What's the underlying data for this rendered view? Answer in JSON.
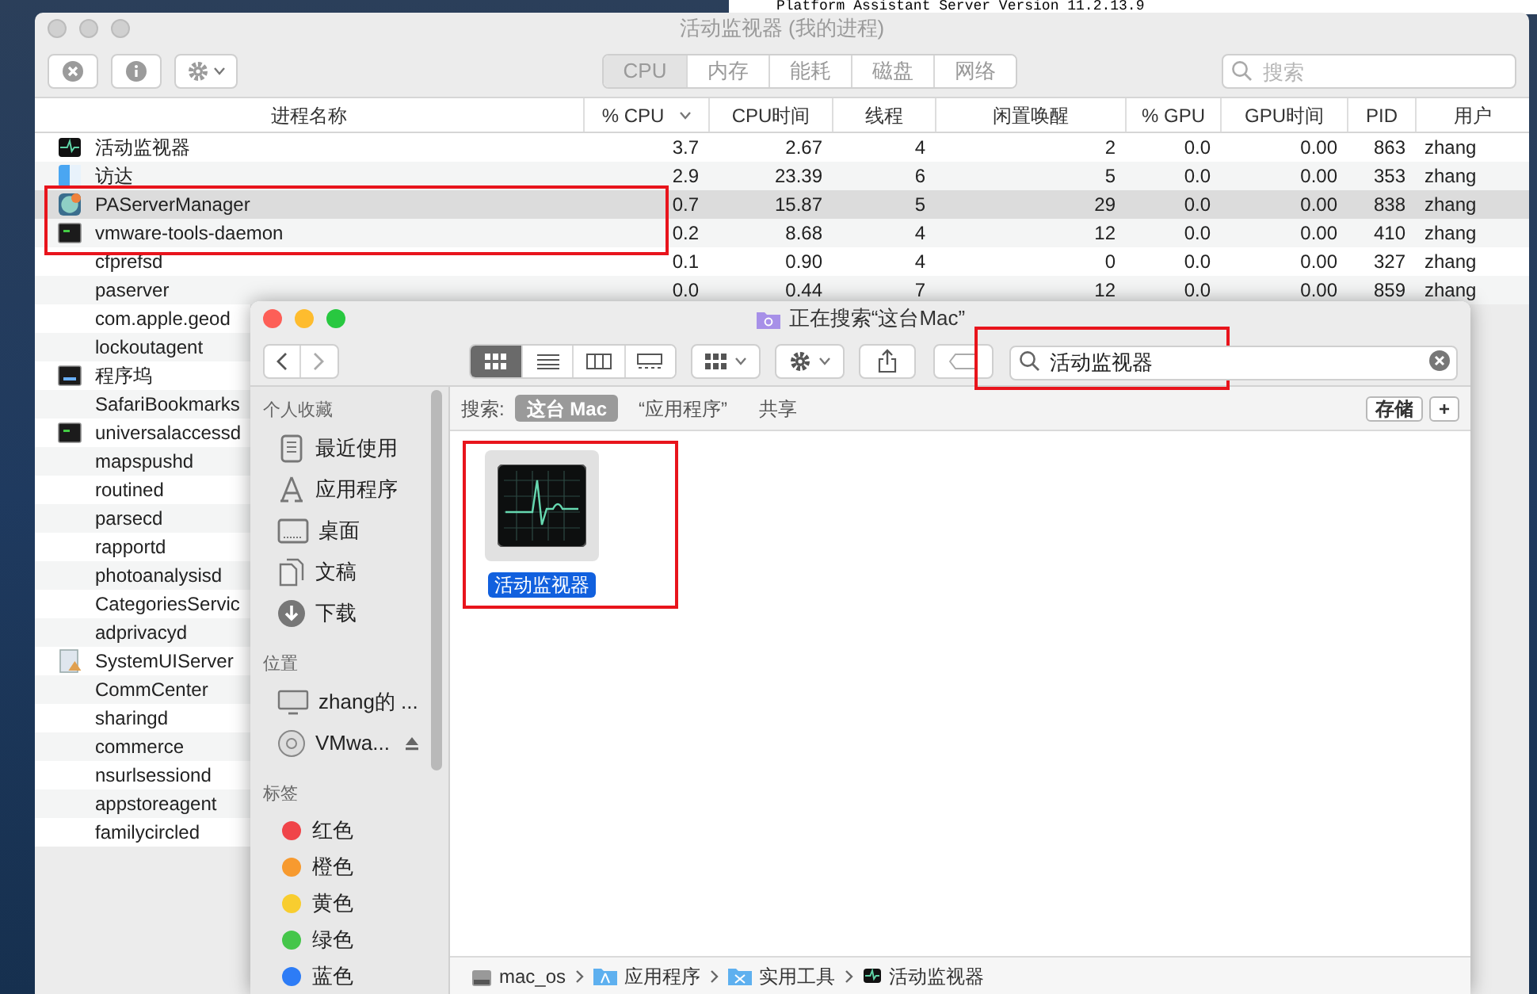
{
  "terminal_text": "Platform Assistant Server  Version 11.2.13.9",
  "activity_monitor": {
    "title": "活动监视器 (我的进程)",
    "tabs": [
      {
        "label": "CPU",
        "selected": true
      },
      {
        "label": "内存",
        "selected": false
      },
      {
        "label": "能耗",
        "selected": false
      },
      {
        "label": "磁盘",
        "selected": false
      },
      {
        "label": "网络",
        "selected": false
      }
    ],
    "search": {
      "placeholder": "搜索"
    },
    "columns": [
      {
        "label": "进程名称",
        "sorted": false
      },
      {
        "label": "% CPU",
        "sorted": true
      },
      {
        "label": "CPU时间",
        "sorted": false
      },
      {
        "label": "线程",
        "sorted": false
      },
      {
        "label": "闲置唤醒",
        "sorted": false
      },
      {
        "label": "% GPU",
        "sorted": false
      },
      {
        "label": "GPU时间",
        "sorted": false
      },
      {
        "label": "PID",
        "sorted": false
      },
      {
        "label": "用户",
        "sorted": false
      }
    ],
    "rows": [
      {
        "kind": "activity",
        "cells": [
          "活动监视器",
          "3.7",
          "2.67",
          "4",
          "2",
          "0.0",
          "0.00",
          "863",
          "zhang"
        ],
        "selected": false,
        "boxed": false
      },
      {
        "kind": "finder",
        "cells": [
          "访达",
          "2.9",
          "23.39",
          "6",
          "5",
          "0.0",
          "0.00",
          "353",
          "zhang"
        ],
        "selected": false,
        "boxed": false
      },
      {
        "kind": "app",
        "cells": [
          "PAServerManager",
          "0.7",
          "15.87",
          "5",
          "29",
          "0.0",
          "0.00",
          "838",
          "zhang"
        ],
        "selected": true,
        "boxed": true
      },
      {
        "kind": "terminal",
        "cells": [
          "vmware-tools-daemon",
          "0.2",
          "8.68",
          "4",
          "12",
          "0.0",
          "0.00",
          "410",
          "zhang"
        ],
        "selected": false,
        "boxed": true
      },
      {
        "kind": "none",
        "cells": [
          "cfprefsd",
          "0.1",
          "0.90",
          "4",
          "0",
          "0.0",
          "0.00",
          "327",
          "zhang"
        ],
        "selected": false,
        "boxed": false
      },
      {
        "kind": "none",
        "cells": [
          "paserver",
          "0.0",
          "0.44",
          "7",
          "12",
          "0.0",
          "0.00",
          "859",
          "zhang"
        ],
        "selected": false,
        "boxed": false
      },
      {
        "kind": "none",
        "cells": [
          "com.apple.geod"
        ],
        "selected": false,
        "boxed": false
      },
      {
        "kind": "none",
        "cells": [
          "lockoutagent"
        ],
        "selected": false,
        "boxed": false
      },
      {
        "kind": "dock",
        "cells": [
          "程序坞"
        ],
        "selected": false,
        "boxed": false
      },
      {
        "kind": "none",
        "cells": [
          "SafariBookmarks"
        ],
        "selected": false,
        "boxed": false
      },
      {
        "kind": "terminal",
        "cells": [
          "universalaccessd"
        ],
        "selected": false,
        "boxed": false
      },
      {
        "kind": "none",
        "cells": [
          "mapspushd"
        ],
        "selected": false,
        "boxed": false
      },
      {
        "kind": "none",
        "cells": [
          "routined"
        ],
        "selected": false,
        "boxed": false
      },
      {
        "kind": "none",
        "cells": [
          "parsecd"
        ],
        "selected": false,
        "boxed": false
      },
      {
        "kind": "none",
        "cells": [
          "rapportd"
        ],
        "selected": false,
        "boxed": false
      },
      {
        "kind": "none",
        "cells": [
          "photoanalysisd"
        ],
        "selected": false,
        "boxed": false
      },
      {
        "kind": "none",
        "cells": [
          "CategoriesServic"
        ],
        "selected": false,
        "boxed": false
      },
      {
        "kind": "none",
        "cells": [
          "adprivacyd"
        ],
        "selected": false,
        "boxed": false
      },
      {
        "kind": "ui-server",
        "cells": [
          "SystemUIServer"
        ],
        "selected": false,
        "boxed": false
      },
      {
        "kind": "none",
        "cells": [
          "CommCenter"
        ],
        "selected": false,
        "boxed": false
      },
      {
        "kind": "none",
        "cells": [
          "sharingd"
        ],
        "selected": false,
        "boxed": false
      },
      {
        "kind": "none",
        "cells": [
          "commerce"
        ],
        "selected": false,
        "boxed": false
      },
      {
        "kind": "none",
        "cells": [
          "nsurlsessiond"
        ],
        "selected": false,
        "boxed": false
      },
      {
        "kind": "none",
        "cells": [
          "appstoreagent"
        ],
        "selected": false,
        "boxed": false
      },
      {
        "kind": "none",
        "cells": [
          "familycircled"
        ],
        "selected": false,
        "boxed": false
      }
    ]
  },
  "finder": {
    "title": "正在搜索“这台Mac”",
    "views": [
      {
        "kind": "icons",
        "selected": true
      },
      {
        "kind": "list",
        "selected": false
      },
      {
        "kind": "columns",
        "selected": false
      },
      {
        "kind": "gallery",
        "selected": false
      }
    ],
    "search": {
      "value": "活动监视器",
      "boxed": true
    },
    "scope": {
      "label": "搜索:",
      "options": [
        {
          "label": "这台 Mac",
          "selected": true
        },
        {
          "label": "“应用程序”",
          "selected": false
        },
        {
          "label": "共享",
          "selected": false
        }
      ],
      "buttons": [
        "存储",
        "+"
      ]
    },
    "sidebar": [
      {
        "title": "个人收藏",
        "items": [
          {
            "label": "最近使用",
            "kind": "recents"
          },
          {
            "label": "应用程序",
            "kind": "apps"
          },
          {
            "label": "桌面",
            "kind": "desktop"
          },
          {
            "label": "文稿",
            "kind": "documents"
          },
          {
            "label": "下载",
            "kind": "downloads"
          }
        ]
      },
      {
        "title": "位置",
        "items": [
          {
            "label": "zhang的 ...",
            "kind": "computer",
            "eject": false
          },
          {
            "label": "VMwa...",
            "kind": "disc",
            "eject": true
          }
        ]
      },
      {
        "title": "标签",
        "items": [
          {
            "label": "红色",
            "color": "#f04449"
          },
          {
            "label": "橙色",
            "color": "#f79a2f"
          },
          {
            "label": "黄色",
            "color": "#f8cd2f"
          },
          {
            "label": "绿色",
            "color": "#45c64a"
          },
          {
            "label": "蓝色",
            "color": "#2d7cf6"
          }
        ]
      }
    ],
    "results": [
      {
        "name": "活动监视器",
        "selected": true,
        "boxed": true
      }
    ],
    "path": [
      {
        "label": "mac_os",
        "kind": "disk"
      },
      {
        "label": "应用程序",
        "kind": "apps-folder"
      },
      {
        "label": "实用工具",
        "kind": "utilities-folder"
      },
      {
        "label": "活动监视器",
        "kind": "activity"
      }
    ]
  }
}
